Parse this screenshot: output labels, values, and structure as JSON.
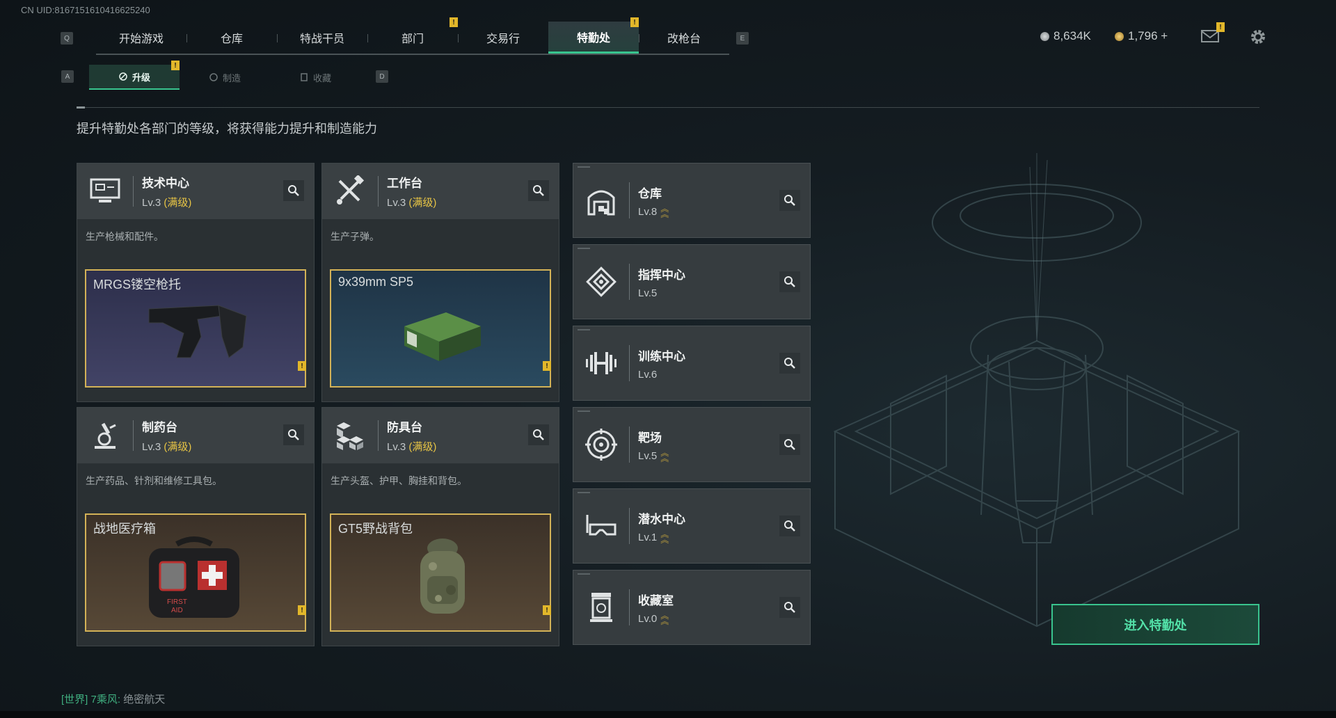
{
  "uid": "CN UID:8167151610416625240",
  "nav": {
    "left_key": "Q",
    "right_key": "E",
    "tabs": [
      "开始游戏",
      "仓库",
      "特战干员",
      "部门",
      "交易行",
      "特勤处",
      "改枪台"
    ],
    "active": "特勤处",
    "badge": "!"
  },
  "currency": {
    "silver": "8,634K",
    "gold": "1,796 +"
  },
  "subnav": {
    "left_key": "A",
    "right_key": "D",
    "tabs": [
      "升级",
      "制造",
      "收藏"
    ],
    "active": "升级"
  },
  "description": "提升特勤处各部门的等级，将获得能力提升和制造能力",
  "big_cards": [
    {
      "title": "技术中心",
      "level": "Lv.3",
      "max": "(满级)",
      "desc": "生产枪械和配件。",
      "product": "MRGS镂空枪托",
      "icon": "monitor-icon"
    },
    {
      "title": "工作台",
      "level": "Lv.3",
      "max": "(满级)",
      "desc": "生产子弹。",
      "product": "9x39mm SP5",
      "icon": "tools-icon"
    },
    {
      "title": "制药台",
      "level": "Lv.3",
      "max": "(满级)",
      "desc": "生产药品、针剂和维修工具包。",
      "product": "战地医疗箱",
      "icon": "microscope-icon"
    },
    {
      "title": "防具台",
      "level": "Lv.3",
      "max": "(满级)",
      "desc": "生产头盔、护甲、胸挂和背包。",
      "product": "GT5野战背包",
      "icon": "boxes-icon"
    }
  ],
  "small_cards": [
    {
      "title": "仓库",
      "level": "Lv.8",
      "upgrade": true,
      "icon": "warehouse-icon"
    },
    {
      "title": "指挥中心",
      "level": "Lv.5",
      "upgrade": false,
      "icon": "command-icon"
    },
    {
      "title": "训练中心",
      "level": "Lv.6",
      "upgrade": false,
      "icon": "dumbbell-icon"
    },
    {
      "title": "靶场",
      "level": "Lv.5",
      "upgrade": true,
      "icon": "target-icon"
    },
    {
      "title": "潜水中心",
      "level": "Lv.1",
      "upgrade": true,
      "icon": "goggles-icon"
    },
    {
      "title": "收藏室",
      "level": "Lv.0",
      "upgrade": true,
      "icon": "collection-icon"
    }
  ],
  "enter_button": "进入特勤处",
  "chat": {
    "channel": "[世界]",
    "user": "7乘风:",
    "message": "绝密航天"
  },
  "colors": {
    "accent": "#38c58f",
    "gold": "#e8c545",
    "badge": "#e2b72a"
  }
}
